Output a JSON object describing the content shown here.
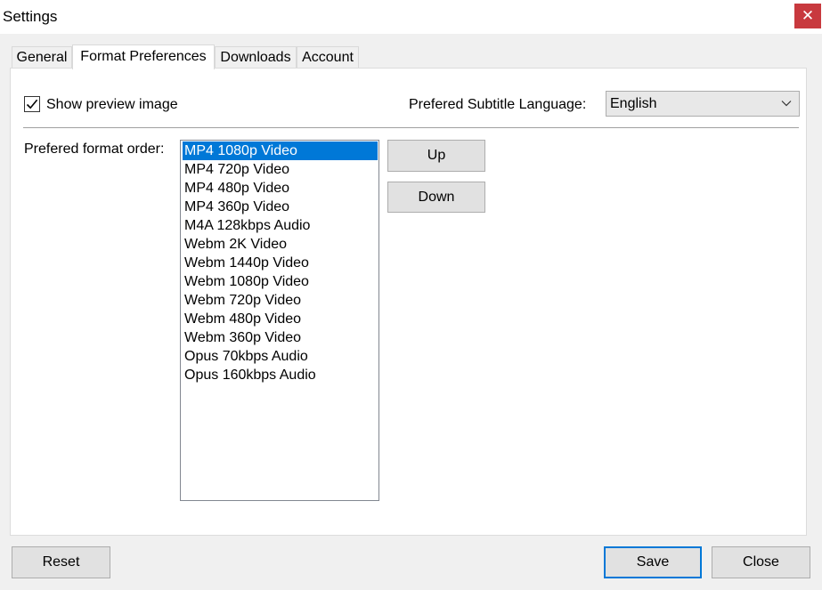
{
  "window": {
    "title": "Settings",
    "close_glyph": "✕"
  },
  "tabs": [
    {
      "label": "General"
    },
    {
      "label": "Format Preferences",
      "active": true
    },
    {
      "label": "Downloads"
    },
    {
      "label": "Account"
    }
  ],
  "preview": {
    "label": "Show preview image",
    "checked": true
  },
  "subtitle": {
    "label": "Prefered Subtitle Language:",
    "value": "English"
  },
  "format_order": {
    "label": "Prefered format order:",
    "selected_index": 0,
    "items": [
      "MP4 1080p Video",
      "MP4 720p Video",
      "MP4 480p Video",
      "MP4 360p Video",
      "M4A 128kbps Audio",
      "Webm 2K Video",
      "Webm 1440p Video",
      "Webm 1080p Video",
      "Webm 720p Video",
      "Webm 480p Video",
      "Webm 360p Video",
      "Opus 70kbps Audio",
      "Opus 160kbps Audio"
    ]
  },
  "buttons": {
    "up": "Up",
    "down": "Down",
    "reset": "Reset",
    "save": "Save",
    "close": "Close"
  },
  "colors": {
    "selection": "#0078d7",
    "close_button": "#c8393e",
    "default_button_border": "#0078d7"
  }
}
